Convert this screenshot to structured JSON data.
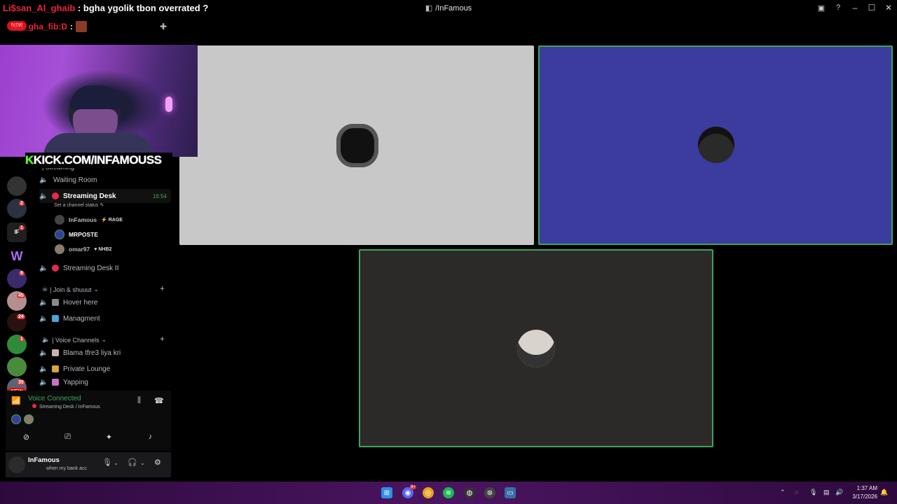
{
  "window": {
    "title": "/InFamous",
    "hash": "ꟷ",
    "icons": [
      "inbox-icon",
      "help-icon",
      "minimize-icon",
      "maximize-icon",
      "close-icon"
    ]
  },
  "chat_overlay": {
    "user": "Li$san_Al_ghaib",
    "message": ": bgha ygolik tbon overrated ?",
    "second_user": "dts_gha_fib:D",
    "second_suffix": ":"
  },
  "server_badges": {
    "new_top": "NEW",
    "new_bottom": "NEW",
    "b1": "2",
    "b2": "1",
    "b3": "1",
    "b4": "9",
    "b5": "45",
    "b6": "24",
    "b7": "1",
    "b8": "35"
  },
  "webcam": {
    "banner_k": "K",
    "banner_text": "KICK.COM/INFAMOUSS"
  },
  "categories": {
    "streaming": "| Streaming",
    "join": "| Join & shuuut",
    "voice": "| Voice Channels"
  },
  "channels": {
    "waiting_room": "Waiting Room",
    "streaming_desk": "Streaming Desk",
    "streaming_desk_timer": "16:54",
    "status_hint": "Set a channel status ✎",
    "streaming_desk_ii": "Streaming Desk II",
    "hover_here": "Hover here",
    "managment": "Managment",
    "blama": "Blama tfre3 liya kri",
    "private_lounge": "Private Lounge",
    "yapping": "Yapping"
  },
  "voice_users": [
    {
      "name": "InFamous",
      "tag": "RAGE"
    },
    {
      "name": "MRPOSTE",
      "tag": ""
    },
    {
      "name": "omar97",
      "tag": "NHB2"
    }
  ],
  "voice_panel": {
    "title": "Voice Connected",
    "subtitle": "Streaming Desk / InFamous"
  },
  "user_panel": {
    "name": "InFamous",
    "status": "when my bank acc"
  },
  "tiles": {
    "tile1_bg": "#c8c8c8",
    "tile2_bg": "#3b3c9e",
    "tile3_bg": "#2b2a28",
    "speaking_border": "#3ba55d"
  },
  "taskbar": {
    "time": "1:37 AM",
    "date": "3/17/2026",
    "discord_badge": "9+"
  }
}
